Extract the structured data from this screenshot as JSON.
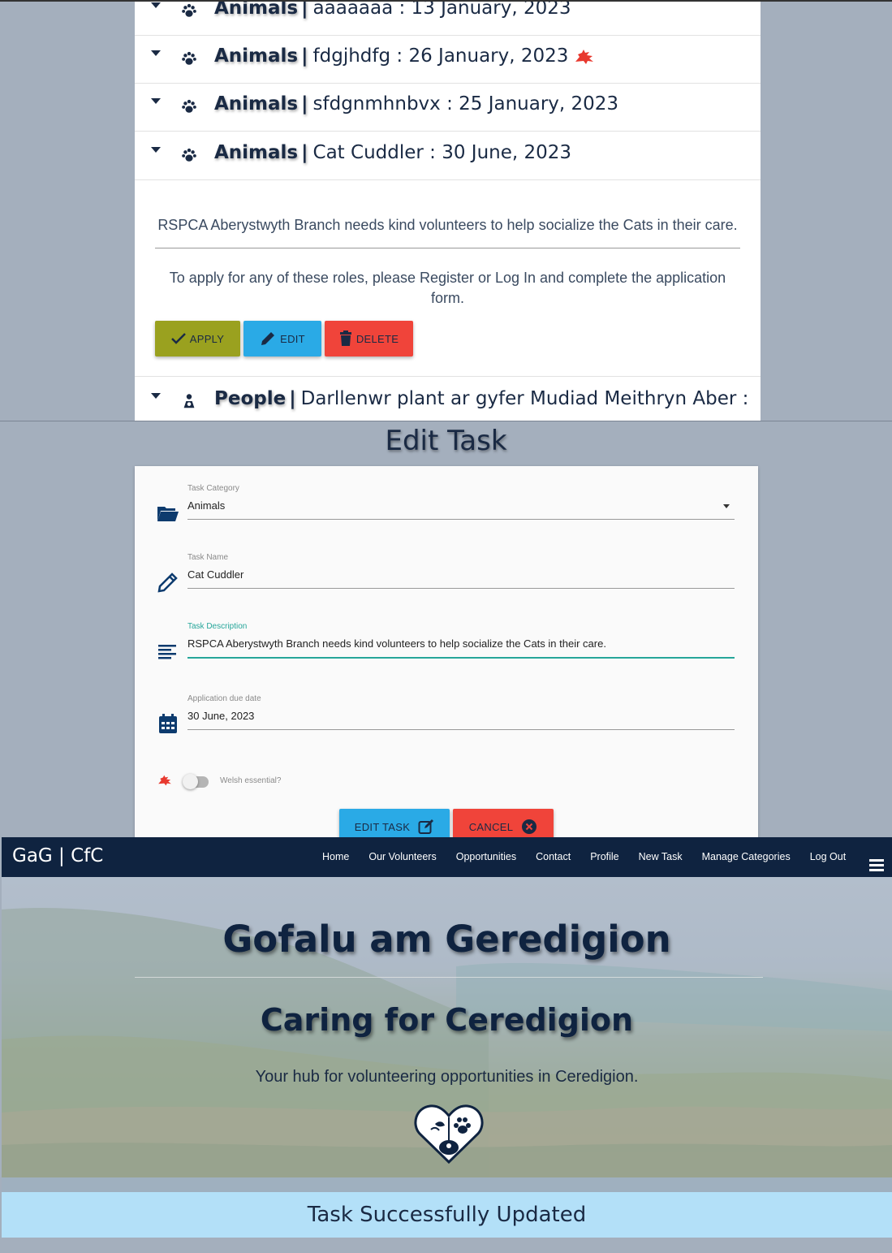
{
  "task_list": {
    "rows": [
      {
        "category": "Animals",
        "name_date": "aaaaaaa : 13 January, 2023",
        "welsh": false
      },
      {
        "category": "Animals",
        "name_date": "fdgjhdfg : 26 January, 2023",
        "welsh": true
      },
      {
        "category": "Animals",
        "name_date": "sfdgnmhnbvx : 25 January, 2023",
        "welsh": false
      },
      {
        "category": "Animals",
        "name_date": "Cat Cuddler : 30 June, 2023",
        "welsh": false
      }
    ],
    "separator": "|",
    "expanded": {
      "description": "RSPCA Aberystwyth Branch needs kind volunteers to help socialize the Cats in their care.",
      "apply_note": "To apply for any of these roles, please Register or Log In and complete the application form.",
      "apply_label": "APPLY",
      "edit_label": "EDIT",
      "delete_label": "DELETE"
    },
    "next_row": {
      "category": "People",
      "name_date": "Darllenwr plant ar gyfer Mudiad Meithryn Aber :"
    }
  },
  "edit_form": {
    "title": "Edit Task",
    "category": {
      "label": "Task Category",
      "value": "Animals"
    },
    "name": {
      "label": "Task Name",
      "value": "Cat Cuddler"
    },
    "description": {
      "label": "Task Description",
      "value": "RSPCA Aberystwyth Branch needs kind volunteers to help socialize the Cats in their care."
    },
    "due_date": {
      "label": "Application due date",
      "value": "30 June, 2023"
    },
    "welsh_toggle": {
      "label": "Welsh essential?",
      "checked": false
    },
    "submit_label": "EDIT TASK",
    "cancel_label": "CANCEL"
  },
  "home": {
    "brand": "GaG | CfC",
    "nav": [
      "Home",
      "Our Volunteers",
      "Opportunities",
      "Contact",
      "Profile",
      "New Task",
      "Manage Categories",
      "Log Out"
    ],
    "heading_cy": "Gofalu am Geredigion",
    "heading_en": "Caring for Ceredigion",
    "subtitle": "Your hub for volunteering opportunities in Ceredigion.",
    "toast": "Task Successfully Updated"
  },
  "colors": {
    "navy": "#0f2340",
    "apply": "#9aa11f",
    "edit": "#2aaae6",
    "delete": "#f0443a",
    "toast": "#b3e0f8",
    "active_field": "#26a69a"
  }
}
